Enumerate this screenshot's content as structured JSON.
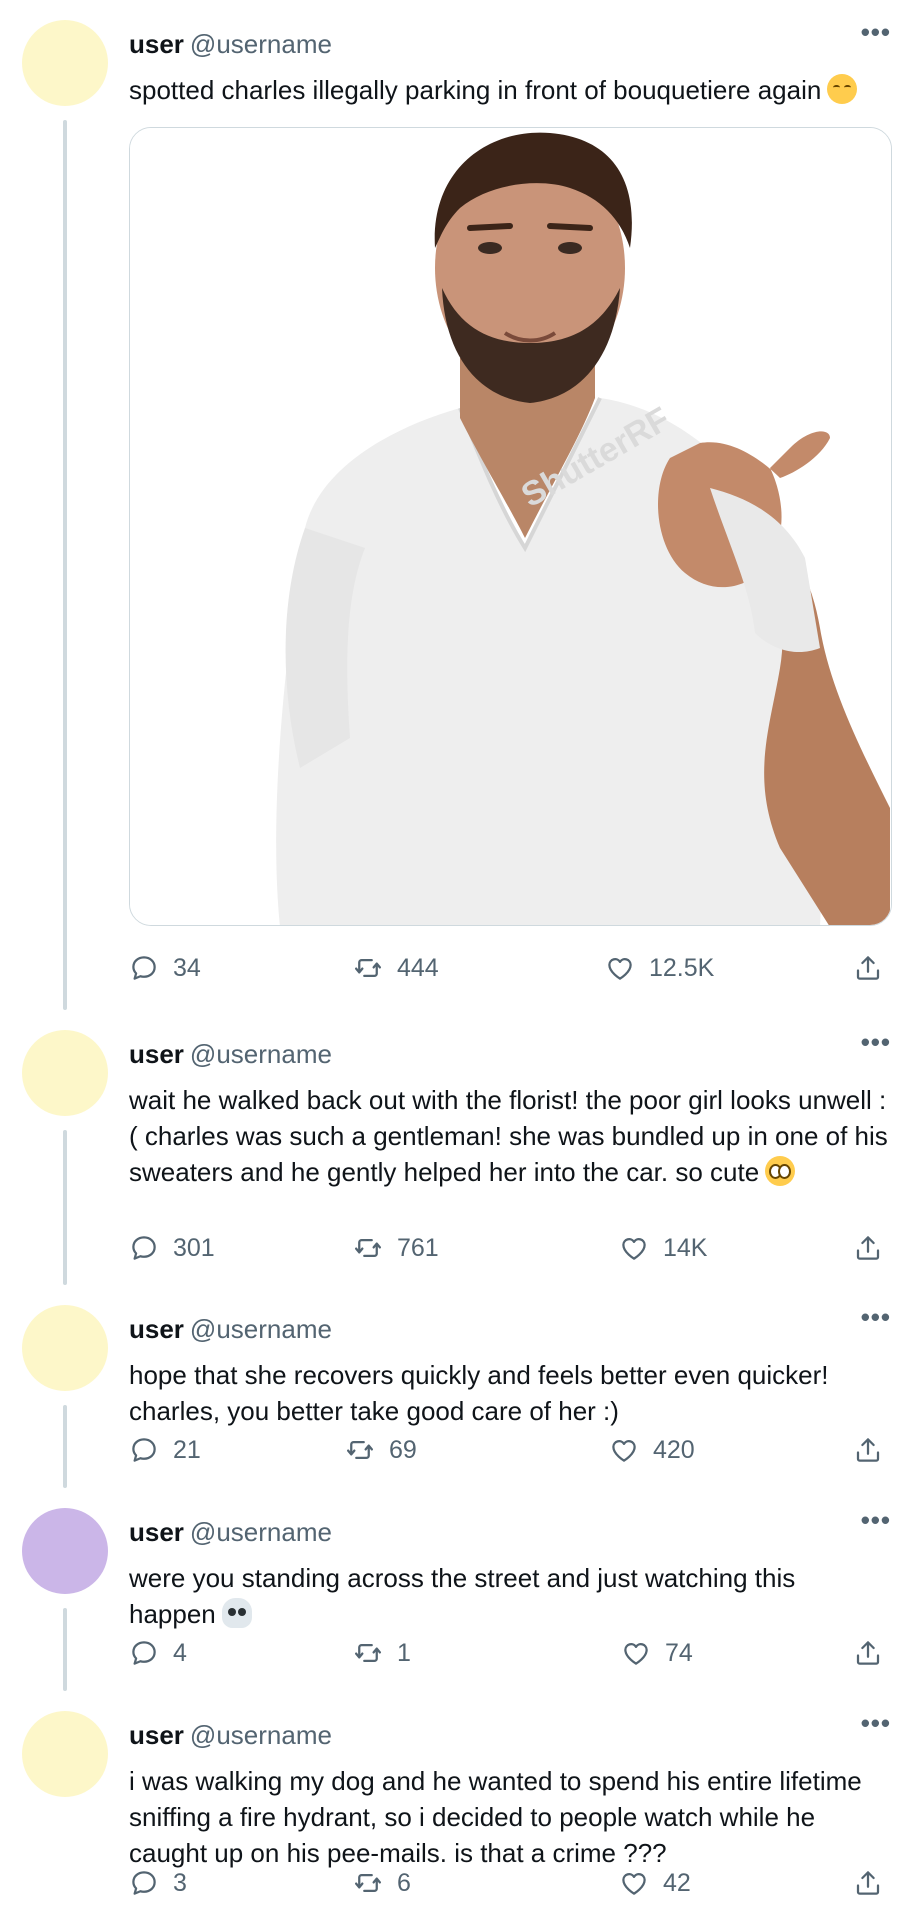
{
  "colors": {
    "avatar_yellow": "#fdf7c9",
    "avatar_purple": "#cbb6e8",
    "thread_line": "#cfd9de",
    "muted_text": "#536471"
  },
  "icons": {
    "reply": "speech-bubble-icon",
    "retweet": "retweet-arrows-icon",
    "like": "heart-icon",
    "share": "share-upload-icon",
    "more": "more-dots-icon"
  },
  "more_label": "•••",
  "tweets": [
    {
      "name": "user",
      "handle": "@username",
      "text": "spotted charles illegally parking in front of bouquetiere again",
      "emoji": "relieved-face",
      "has_media": true,
      "media": {
        "description_tag": "man-in-white-tshirt-thumb-pointing",
        "watermark": "ShutterRF"
      },
      "replies": "34",
      "retweets": "444",
      "likes": "12.5K"
    },
    {
      "name": "user",
      "handle": "@username",
      "text": "wait he walked back out with the florist! the poor girl looks unwell :( charles was such a gentleman! she was bundled up in one of his sweaters and he gently helped her into the car. so cute",
      "emoji": "pleading-face",
      "replies": "301",
      "retweets": "761",
      "likes": "14K"
    },
    {
      "name": "user",
      "handle": "@username",
      "text": "hope that she recovers quickly and feels better even quicker! charles, you better take good care of her :)",
      "replies": "21",
      "retweets": "69",
      "likes": "420"
    },
    {
      "name": "user",
      "handle": "@username",
      "text": "were you standing across the street and just watching this happen",
      "emoji": "skull",
      "replies": "4",
      "retweets": "1",
      "likes": "74"
    },
    {
      "name": "user",
      "handle": "@username",
      "text": "i was walking my dog and he wanted to spend his entire lifetime sniffing a fire hydrant, so i decided to people watch while he caught up on his pee-mails. is that a crime ???",
      "replies": "3",
      "retweets": "6",
      "likes": "42"
    }
  ]
}
